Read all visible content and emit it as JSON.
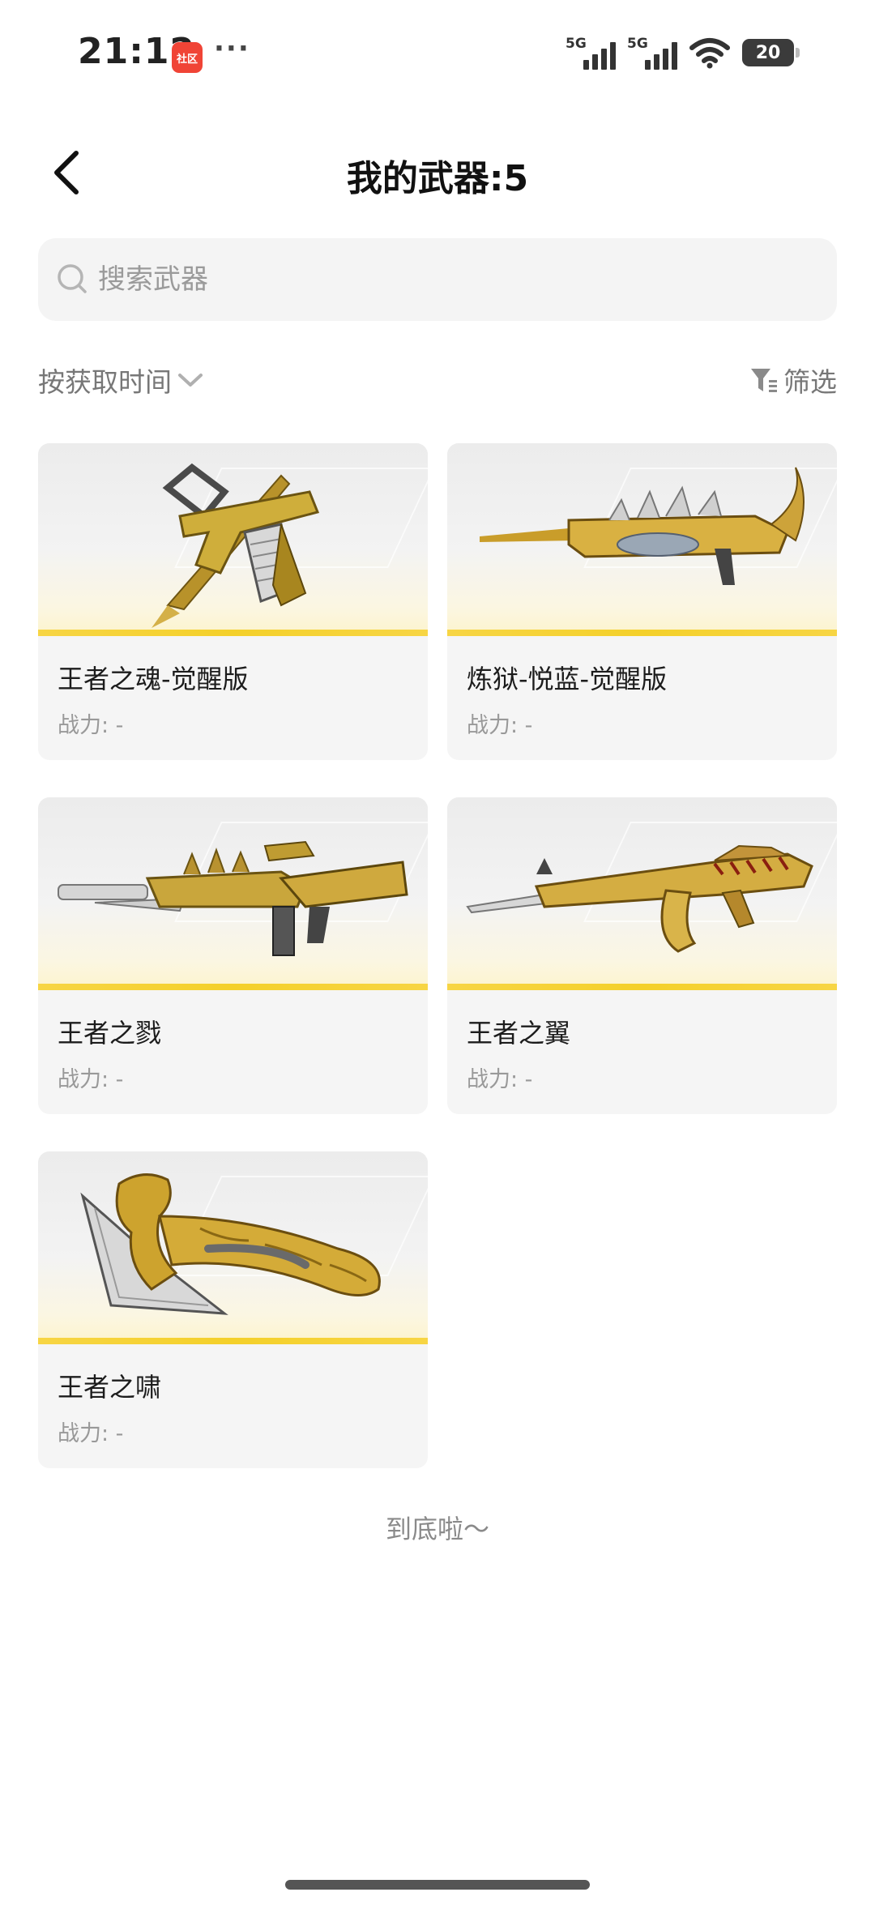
{
  "status_bar": {
    "time": "21:12",
    "app_badge": "社区",
    "dots": "···",
    "network_1": "5G",
    "network_2": "5G",
    "battery": "20"
  },
  "header": {
    "title": "我的武器:5"
  },
  "search": {
    "placeholder": "搜索武器"
  },
  "toolbar": {
    "sort_label": "按获取时间",
    "filter_label": "筛选"
  },
  "weapons": [
    {
      "name": "王者之魂-觉醒版",
      "power": "战力: -",
      "image_icon": "pistol-with-blade"
    },
    {
      "name": "炼狱-悦蓝-觉醒版",
      "power": "战力: -",
      "image_icon": "dragon-rifle"
    },
    {
      "name": "王者之戮",
      "power": "战力: -",
      "image_icon": "gold-assault-rifle"
    },
    {
      "name": "王者之翼",
      "power": "战力: -",
      "image_icon": "gold-ak-rifle"
    },
    {
      "name": "王者之啸",
      "power": "战力: -",
      "image_icon": "gold-lion-axe"
    }
  ],
  "footer": {
    "end_text": "到底啦～"
  },
  "colors": {
    "accent_yellow": "#f4d02a",
    "gold": "#c9a227",
    "card_bg": "#f5f5f5"
  }
}
